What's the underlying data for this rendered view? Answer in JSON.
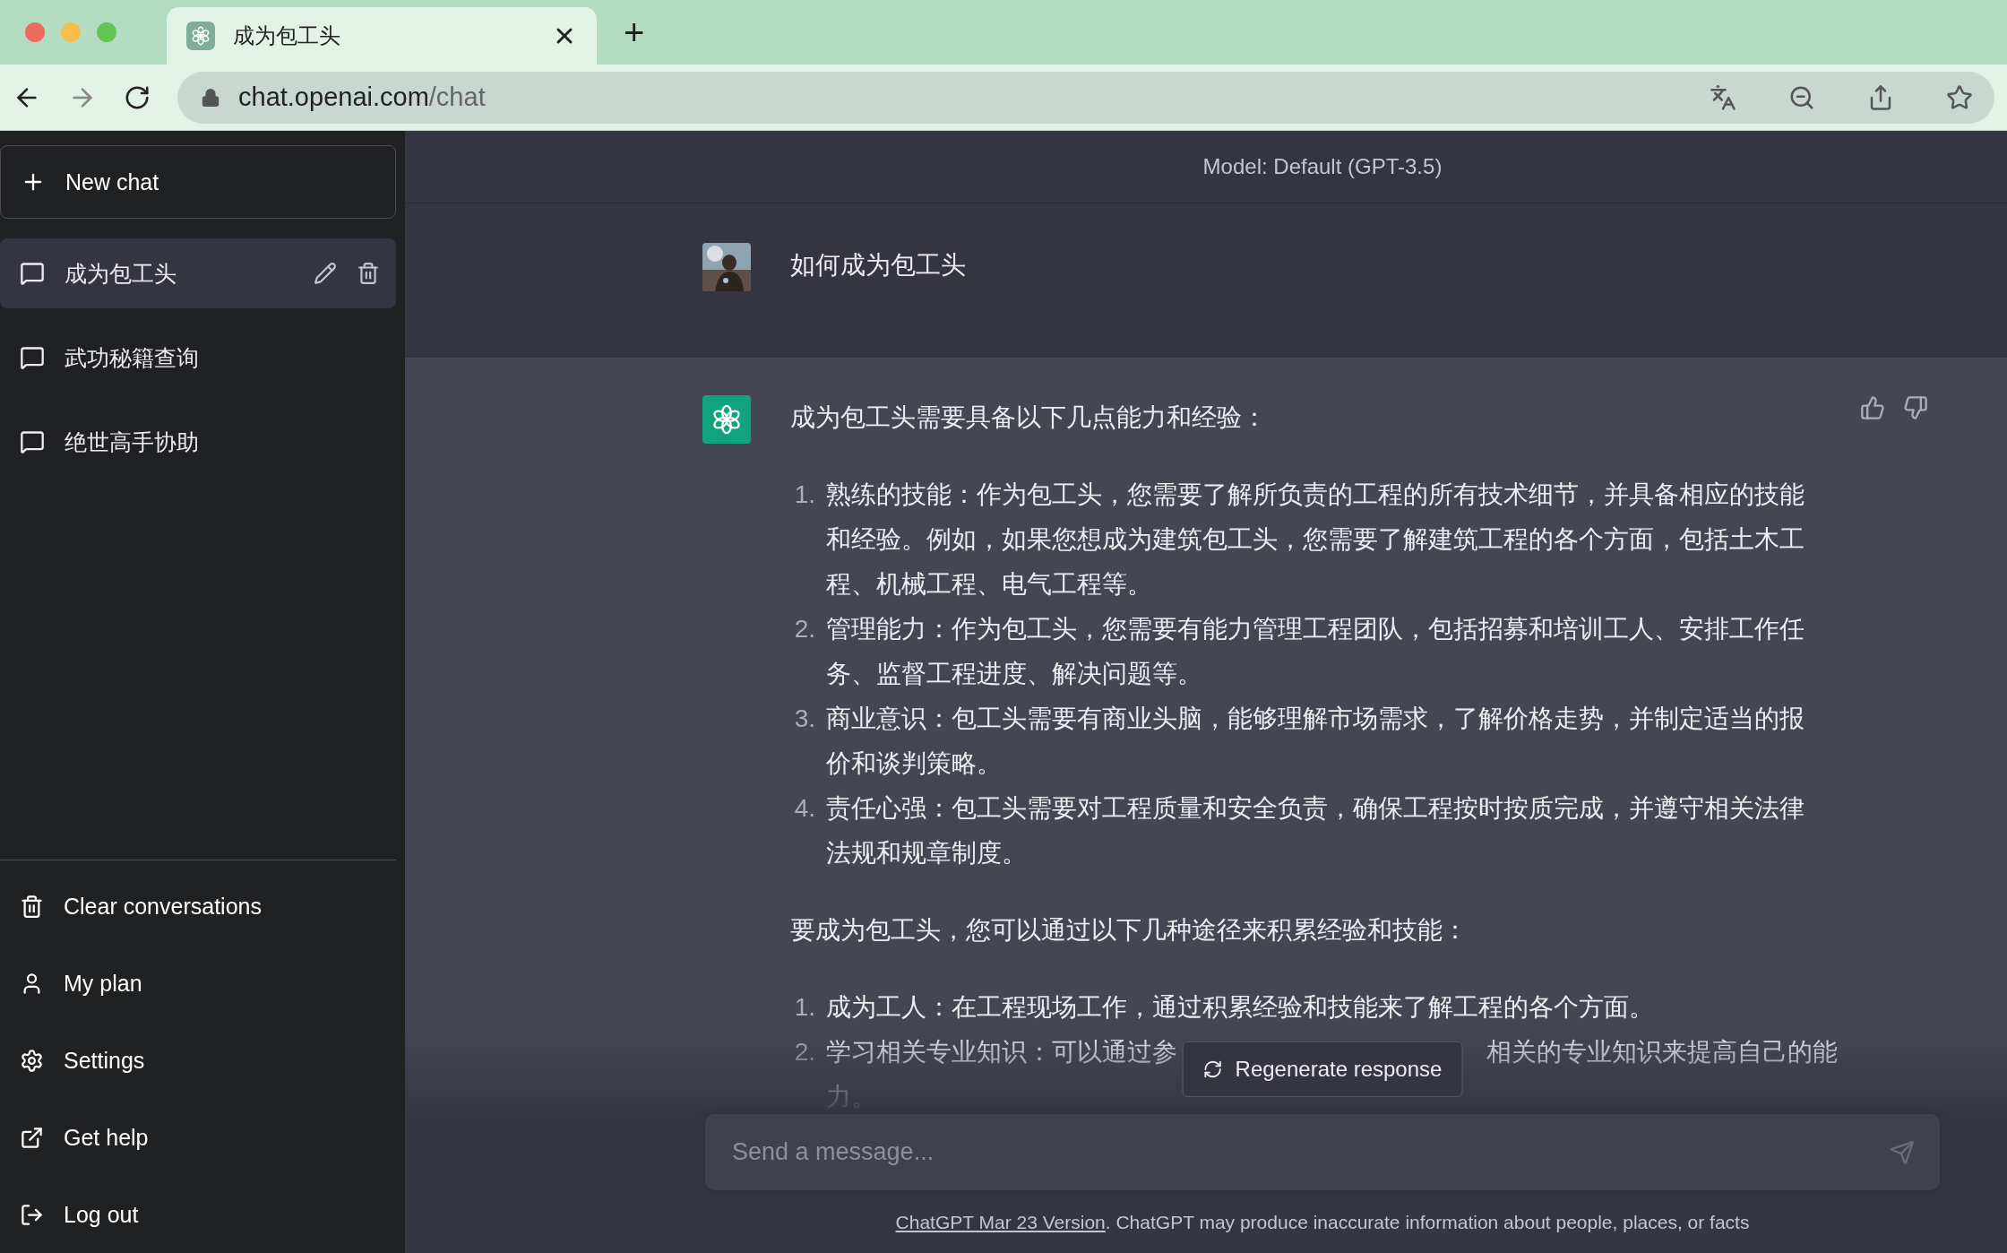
{
  "browser": {
    "tab": {
      "title": "成为包工头",
      "selected": true
    },
    "new_tab": "+",
    "url_host": "chat.openai.com",
    "url_path": "/chat"
  },
  "sidebar": {
    "new_chat": "New chat",
    "conversations": [
      {
        "title": "成为包工头",
        "selected": true
      },
      {
        "title": "武功秘籍查询",
        "selected": false
      },
      {
        "title": "绝世高手协助",
        "selected": false
      }
    ],
    "menu": [
      {
        "label": "Clear conversations",
        "kind": "clear"
      },
      {
        "label": "My plan",
        "kind": "plan"
      },
      {
        "label": "Settings",
        "kind": "settings"
      },
      {
        "label": "Get help",
        "kind": "help"
      },
      {
        "label": "Log out",
        "kind": "logout"
      }
    ]
  },
  "chat": {
    "model": "Model: Default (GPT-3.5)",
    "messages": [
      {
        "kind": "user",
        "blocks": [
          {
            "kind": "paragraph",
            "text": "如何成为包工头"
          }
        ]
      },
      {
        "kind": "assistant",
        "blocks": [
          {
            "kind": "paragraph",
            "text": "成为包工头需要具备以下几点能力和经验："
          },
          {
            "kind": "list",
            "items": [
              {
                "marker": "1.",
                "lines": [
                  [
                    "熟练的技能：作为包工头，您需要了解所负责的工程的所有技术细节，并具备相应的技能和经验。例如，如果您想成为建筑包工头，您需要了解建筑工程的各个方面，包括土木工程、机械工程、电气工程等。"
                  ]
                ]
              },
              {
                "marker": "2.",
                "lines": [
                  [
                    "管理能力：作为包工头，您需要有能力管理工程团队，包括招募和培训工人、安排工作任务、监督工程进度、解决问题等。"
                  ]
                ]
              },
              {
                "marker": "3.",
                "lines": [
                  [
                    "商业意识：包工头需要有商业头脑，能够理解市场需求，了解价格走势，并制定适当的报价和谈判策略。"
                  ]
                ]
              },
              {
                "marker": "4.",
                "lines": [
                  [
                    "责任心强：包工头需要对工程质量和安全负责，确保工程按时按质完成，并遵守相关法律法规和规章制度。"
                  ]
                ]
              }
            ]
          },
          {
            "kind": "paragraph",
            "text": "要成为包工头，您可以通过以下几种途径来积累经验和技能："
          },
          {
            "kind": "list",
            "items": [
              {
                "marker": "1.",
                "lines": [
                  [
                    "成为工人：在工程现场工作，通过积累经验和技能来了解工程的各个方面。"
                  ]
                ]
              },
              {
                "marker": "2.",
                "lines": [
                  [
                    "学习相关专业知识：可以通过参",
                    "相关的专业知识来提高自己的能"
                  ],
                  [
                    "力。"
                  ]
                ]
              }
            ]
          }
        ]
      }
    ]
  },
  "regenerate": "Regenerate response",
  "composer": {
    "placeholder": "Send a message..."
  },
  "footer": {
    "link": "ChatGPT Mar 23 Version",
    "text": ". ChatGPT may produce inaccurate information about people, places, or facts"
  }
}
